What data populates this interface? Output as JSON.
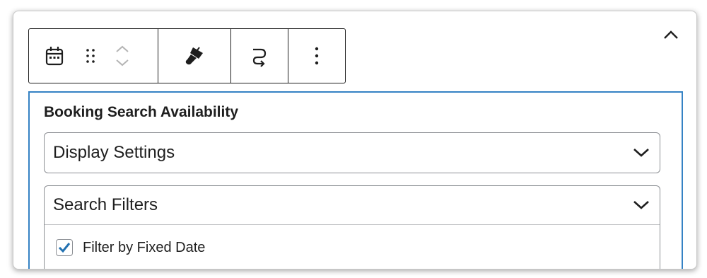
{
  "block_toolbar": {
    "block_icon": "calendar-icon",
    "drag_icon": "drag-handle-icon",
    "move_up_icon": "chevron-up-icon",
    "move_down_icon": "chevron-down-icon",
    "style_icon": "paintbrush-icon",
    "transform_icon": "loop-arrow-icon",
    "more_icon": "more-vertical-icon"
  },
  "collapse_icon": "chevron-up-icon",
  "panel": {
    "title": "Booking Search Availability",
    "sections": [
      {
        "label": "Display Settings",
        "expanded": false
      },
      {
        "label": "Search Filters",
        "expanded": true
      }
    ],
    "options": [
      {
        "label": "Filter by Fixed Date",
        "checked": true
      }
    ]
  },
  "colors": {
    "accent": "#3582c4",
    "border": "#8c8f94",
    "text": "#1e1e1e"
  }
}
